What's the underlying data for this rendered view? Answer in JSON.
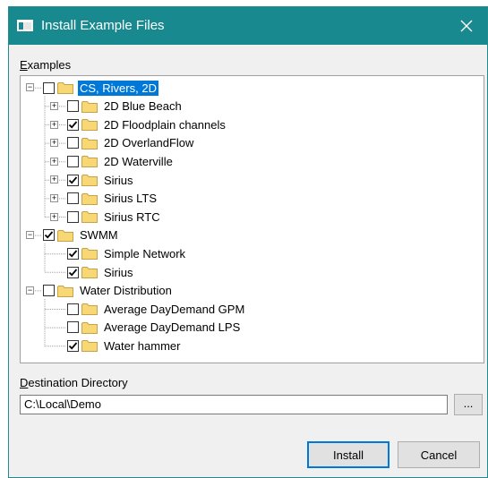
{
  "window": {
    "title": "Install Example Files"
  },
  "examples_label": {
    "underlined": "E",
    "rest": "xamples"
  },
  "tree": {
    "items": [
      {
        "label": "CS, Rivers, 2D",
        "checked": false,
        "expander": "minus",
        "level": 0,
        "selected": true
      },
      {
        "label": "2D Blue Beach",
        "checked": false,
        "expander": "plus",
        "level": 1
      },
      {
        "label": "2D Floodplain channels",
        "checked": true,
        "expander": "plus",
        "level": 1
      },
      {
        "label": "2D OverlandFlow",
        "checked": false,
        "expander": "plus",
        "level": 1
      },
      {
        "label": "2D Waterville",
        "checked": false,
        "expander": "plus",
        "level": 1
      },
      {
        "label": "Sirius",
        "checked": true,
        "expander": "plus",
        "level": 1
      },
      {
        "label": "Sirius LTS",
        "checked": false,
        "expander": "plus",
        "level": 1
      },
      {
        "label": "Sirius RTC",
        "checked": false,
        "expander": "plus",
        "level": 1
      },
      {
        "label": "SWMM",
        "checked": true,
        "expander": "minus",
        "level": 0
      },
      {
        "label": "Simple Network",
        "checked": true,
        "expander": "none",
        "level": 1
      },
      {
        "label": "Sirius",
        "checked": true,
        "expander": "none",
        "level": 1
      },
      {
        "label": "Water Distribution",
        "checked": false,
        "expander": "minus",
        "level": 0
      },
      {
        "label": "Average DayDemand GPM",
        "checked": false,
        "expander": "none",
        "level": 1
      },
      {
        "label": "Average DayDemand LPS",
        "checked": false,
        "expander": "none",
        "level": 1
      },
      {
        "label": "Water hammer",
        "checked": true,
        "expander": "none",
        "level": 1
      }
    ]
  },
  "destination": {
    "label_underlined": "D",
    "label_rest": "estination Directory",
    "value": "C:\\Local\\Demo",
    "browse_label": "..."
  },
  "buttons": {
    "install": "Install",
    "cancel": "Cancel"
  },
  "colors": {
    "titlebar": "#188a8f",
    "selection": "#0078d7",
    "folder_fill": "#f8d775",
    "folder_stroke": "#c8a24a"
  },
  "icons": {
    "app": "window-icon",
    "close": "close-icon",
    "folder": "folder-icon",
    "check": "checkmark-icon"
  }
}
